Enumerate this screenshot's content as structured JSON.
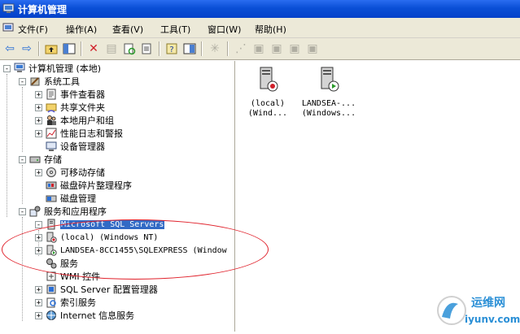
{
  "window": {
    "title": "计算机管理"
  },
  "menu": [
    {
      "label": "文件(F)"
    },
    {
      "label": "操作(A)"
    },
    {
      "label": "查看(V)"
    },
    {
      "label": "工具(T)"
    },
    {
      "label": "窗口(W)"
    },
    {
      "label": "帮助(H)"
    }
  ],
  "tree": [
    {
      "label": "计算机管理 (本地)",
      "level": 0,
      "expander": "-",
      "icon": "computer-management-icon"
    },
    {
      "label": "系统工具",
      "level": 1,
      "expander": "-",
      "icon": "system-tools-icon"
    },
    {
      "label": "事件查看器",
      "level": 2,
      "expander": "+",
      "icon": "event-viewer-icon"
    },
    {
      "label": "共享文件夹",
      "level": 2,
      "expander": "+",
      "icon": "shared-folder-icon"
    },
    {
      "label": "本地用户和组",
      "level": 2,
      "expander": "+",
      "icon": "users-icon"
    },
    {
      "label": "性能日志和警报",
      "level": 2,
      "expander": "+",
      "icon": "performance-icon"
    },
    {
      "label": "设备管理器",
      "level": 2,
      "expander": "",
      "icon": "device-manager-icon"
    },
    {
      "label": "存储",
      "level": 1,
      "expander": "-",
      "icon": "storage-icon"
    },
    {
      "label": "可移动存储",
      "level": 2,
      "expander": "+",
      "icon": "removable-storage-icon"
    },
    {
      "label": "磁盘碎片整理程序",
      "level": 2,
      "expander": "",
      "icon": "defrag-icon"
    },
    {
      "label": "磁盘管理",
      "level": 2,
      "expander": "",
      "icon": "disk-management-icon"
    },
    {
      "label": "服务和应用程序",
      "level": 1,
      "expander": "-",
      "icon": "services-apps-icon"
    },
    {
      "label": "Microsoft SQL Servers",
      "level": 2,
      "expander": "-",
      "icon": "sql-servers-icon",
      "selected": true,
      "mono": true
    },
    {
      "label": "(local) (Windows NT)",
      "level": 3,
      "expander": "+",
      "icon": "sql-server-stopped-icon",
      "mono": true
    },
    {
      "label": "LANDSEA-8CC1455\\SQLEXPRESS (Window",
      "level": 3,
      "expander": "+",
      "icon": "sql-server-running-icon",
      "mono": true
    },
    {
      "label": "服务",
      "level": 2,
      "expander": "",
      "icon": "services-icon"
    },
    {
      "label": "WMI 控件",
      "level": 2,
      "expander": "",
      "icon": "wmi-icon"
    },
    {
      "label": "SQL Server 配置管理器",
      "level": 2,
      "expander": "+",
      "icon": "sql-config-icon"
    },
    {
      "label": "索引服务",
      "level": 2,
      "expander": "+",
      "icon": "index-icon"
    },
    {
      "label": "Internet 信息服务",
      "level": 2,
      "expander": "+",
      "icon": "iis-icon"
    }
  ],
  "content_items": [
    {
      "line1": "(local)",
      "line2": "(Wind...",
      "status": "stopped"
    },
    {
      "line1": "LANDSEA-...",
      "line2": "(Windows...",
      "status": "running"
    }
  ],
  "watermark": {
    "text_cn": "运维网",
    "text_url": "iyunv.com"
  },
  "colors": {
    "titlebar": "#0a4fd6",
    "selection": "#316ac5",
    "annotation": "#e0202a",
    "watermark": "#2a8fd6"
  }
}
